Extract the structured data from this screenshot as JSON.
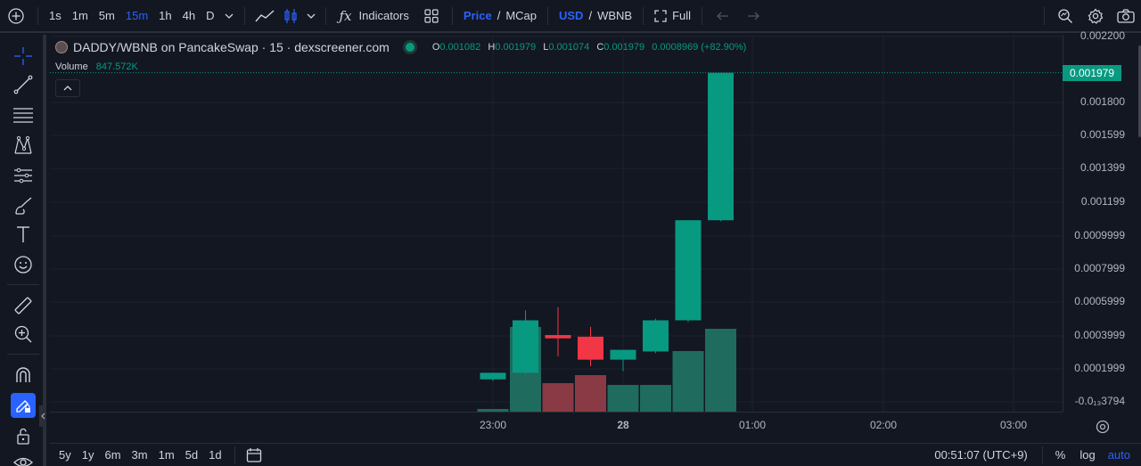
{
  "toolbar": {
    "intervals": [
      "1s",
      "1m",
      "5m",
      "15m",
      "1h",
      "4h",
      "D"
    ],
    "active_interval": "15m",
    "indicators_label": "Indicators",
    "price_label": "Price",
    "mcap_label": "MCap",
    "usd_label": "USD",
    "wbnb_label": "WBNB",
    "full_label": "Full",
    "slash": "/"
  },
  "legend": {
    "title": "DADDY/WBNB on PancakeSwap · 15 · dexscreener.com",
    "o_key": "O",
    "o_val": "0.001082",
    "h_key": "H",
    "h_val": "0.001979",
    "l_key": "L",
    "l_val": "0.001074",
    "c_key": "C",
    "c_val": "0.001979",
    "change": "0.0008969 (+82.90%)",
    "volume_label": "Volume",
    "volume_value": "847.572K"
  },
  "price_scale": {
    "ticks": [
      "0.002200",
      "0.001800",
      "0.001599",
      "0.001399",
      "0.001199",
      "0.0009999",
      "0.0007999",
      "0.0005999",
      "0.0003999",
      "0.0001999",
      "-0.0₁₃3794"
    ],
    "last_price": "0.001979"
  },
  "time_axis": {
    "ticks": [
      "23:00",
      "28",
      "01:00",
      "02:00",
      "03:00"
    ]
  },
  "bottombar": {
    "ranges": [
      "5y",
      "1y",
      "6m",
      "3m",
      "1m",
      "5d",
      "1d"
    ],
    "clock": "00:51:07 (UTC+9)",
    "percent": "%",
    "log": "log",
    "auto": "auto"
  },
  "colors": {
    "up": "#089981",
    "down": "#f23645",
    "vol_up": "#1f6b5e",
    "vol_down": "#8a3a44",
    "accent": "#2962ff"
  },
  "chart_data": {
    "type": "candlestick",
    "ylim": [
      0,
      0.0022
    ],
    "candles": [
      {
        "o": 0.00011,
        "h": 0.00015,
        "l": 0.0001,
        "c": 0.00015,
        "vol": 0.03
      },
      {
        "o": 0.00015,
        "h": 0.00053,
        "l": 0.00014,
        "c": 0.00047,
        "vol": 0.95
      },
      {
        "o": 0.00038,
        "h": 0.00055,
        "l": 0.00025,
        "c": 0.00036,
        "vol": 0.32
      },
      {
        "o": 0.00037,
        "h": 0.00043,
        "l": 0.00019,
        "c": 0.00023,
        "vol": 0.41
      },
      {
        "o": 0.00023,
        "h": 0.00029,
        "l": 0.00016,
        "c": 0.00029,
        "vol": 0.3
      },
      {
        "o": 0.00028,
        "h": 0.00048,
        "l": 0.00027,
        "c": 0.00047,
        "vol": 0.3
      },
      {
        "o": 0.00047,
        "h": 0.00108,
        "l": 0.00046,
        "c": 0.00108,
        "vol": 0.68
      },
      {
        "o": 0.00108,
        "h": 0.001979,
        "l": 0.001074,
        "c": 0.001979,
        "vol": 0.93
      }
    ]
  }
}
